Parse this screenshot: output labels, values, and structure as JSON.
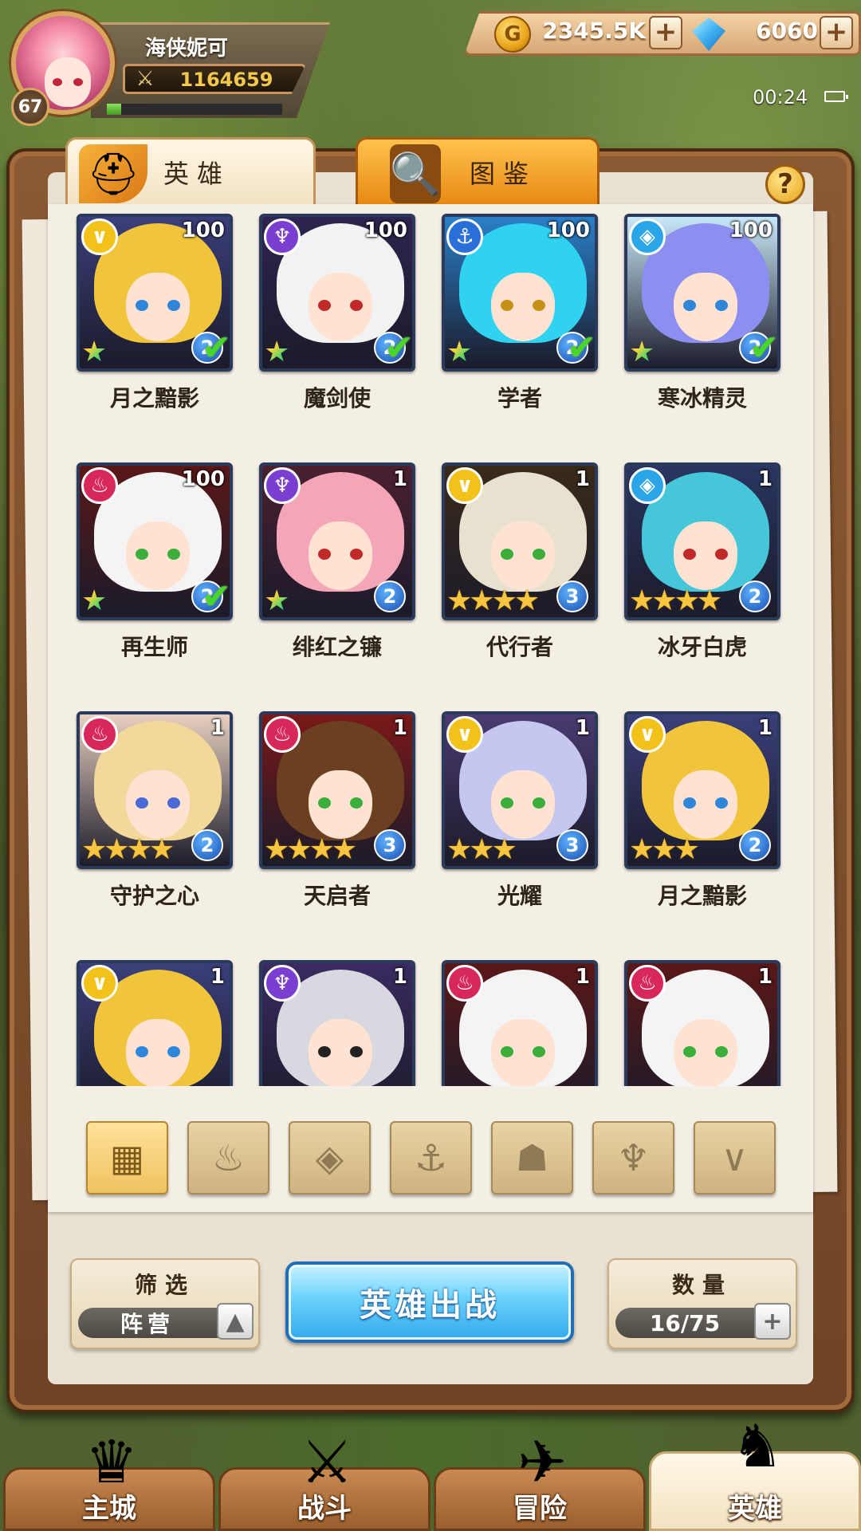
{
  "player": {
    "name": "海侠妮可",
    "level": "67",
    "power": "1164659",
    "xp_fraction": 0.08
  },
  "currency": {
    "gold": "2345.5K",
    "gems": "6060",
    "plus_glyph": "+"
  },
  "status": {
    "time": "00:24"
  },
  "tabs": [
    {
      "label": "英雄",
      "icon": "helmet-icon",
      "active": true
    },
    {
      "label": "图鉴",
      "icon": "magnifier-icon",
      "active": false
    }
  ],
  "help_label": "?",
  "heroes": [
    {
      "name": "月之黯影",
      "level": "100",
      "grade": "2",
      "stars": 1,
      "star_type": "rainbow",
      "collected": true,
      "faction": "light",
      "faction_color": "#f2c21b",
      "hair": "#f0c53c",
      "bg": "#3b3f7a",
      "eye": "#2f86d8"
    },
    {
      "name": "魔剑使",
      "level": "100",
      "grade": "2",
      "stars": 1,
      "star_type": "rainbow",
      "collected": true,
      "faction": "dark",
      "faction_color": "#7a3fd1",
      "hair": "#f2f2f2",
      "bg": "#2e2450",
      "eye": "#c02a2a"
    },
    {
      "name": "学者",
      "level": "100",
      "grade": "2",
      "stars": 1,
      "star_type": "rainbow",
      "collected": true,
      "faction": "water",
      "faction_color": "#2a6ed8",
      "hair": "#2fd3f0",
      "bg": "#2a7fc8",
      "eye": "#c79016"
    },
    {
      "name": "寒冰精灵",
      "level": "100",
      "grade": "2",
      "stars": 1,
      "star_type": "rainbow",
      "collected": true,
      "faction": "ice",
      "faction_color": "#2aa6e8",
      "hair": "#8d8ff0",
      "bg": "#c8e8f8",
      "eye": "#2f86d8"
    },
    {
      "name": "再生师",
      "level": "100",
      "grade": "2",
      "stars": 1,
      "star_type": "rainbow",
      "collected": true,
      "faction": "fire",
      "faction_color": "#d8285a",
      "hair": "#f4f4f4",
      "bg": "#5a1818",
      "eye": "#3cae3c"
    },
    {
      "name": "绯红之镰",
      "level": "1",
      "grade": "2",
      "stars": 1,
      "star_type": "rainbow",
      "collected": false,
      "faction": "dark",
      "faction_color": "#7a3fd1",
      "hair": "#f5a5b8",
      "bg": "#4a2030",
      "eye": "#c02a2a"
    },
    {
      "name": "代行者",
      "level": "1",
      "grade": "3",
      "stars": 4,
      "star_type": "gold",
      "collected": false,
      "faction": "light",
      "faction_color": "#f2c21b",
      "hair": "#e9e1cf",
      "bg": "#3a2a1a",
      "eye": "#3cae3c"
    },
    {
      "name": "冰牙白虎",
      "level": "1",
      "grade": "2",
      "stars": 4,
      "star_type": "gold",
      "collected": false,
      "faction": "ice",
      "faction_color": "#2aa6e8",
      "hair": "#46c7d9",
      "bg": "#2a3560",
      "eye": "#c02a2a"
    },
    {
      "name": "守护之心",
      "level": "1",
      "grade": "2",
      "stars": 4,
      "star_type": "gold",
      "collected": false,
      "faction": "fire",
      "faction_color": "#d8285a",
      "hair": "#f2d89a",
      "bg": "#e8d0c0",
      "eye": "#4a6ad8"
    },
    {
      "name": "天启者",
      "level": "1",
      "grade": "3",
      "stars": 4,
      "star_type": "gold",
      "collected": false,
      "faction": "fire",
      "faction_color": "#d8285a",
      "hair": "#6a4020",
      "bg": "#7a1818",
      "eye": "#3cae3c"
    },
    {
      "name": "光耀",
      "level": "1",
      "grade": "3",
      "stars": 3,
      "star_type": "gold",
      "collected": false,
      "faction": "light",
      "faction_color": "#f2c21b",
      "hair": "#c4c8f0",
      "bg": "#4a3a70",
      "eye": "#3cae3c"
    },
    {
      "name": "月之黯影",
      "level": "1",
      "grade": "2",
      "stars": 3,
      "star_type": "gold",
      "collected": false,
      "faction": "light",
      "faction_color": "#f2c21b",
      "hair": "#f0c53c",
      "bg": "#3b3f7a",
      "eye": "#2f86d8"
    },
    {
      "name": "",
      "level": "1",
      "grade": "",
      "stars": 0,
      "star_type": "gold",
      "collected": false,
      "faction": "light",
      "faction_color": "#f2c21b",
      "hair": "#f0c53c",
      "bg": "#3b3f7a",
      "eye": "#2f86d8"
    },
    {
      "name": "",
      "level": "1",
      "grade": "",
      "stars": 0,
      "star_type": "gold",
      "collected": false,
      "faction": "dark",
      "faction_color": "#7a3fd1",
      "hair": "#d8d8e0",
      "bg": "#3a2a60",
      "eye": "#222222"
    },
    {
      "name": "",
      "level": "1",
      "grade": "",
      "stars": 0,
      "star_type": "gold",
      "collected": false,
      "faction": "fire",
      "faction_color": "#d8285a",
      "hair": "#f4f4f4",
      "bg": "#5a1818",
      "eye": "#3cae3c"
    },
    {
      "name": "",
      "level": "1",
      "grade": "",
      "stars": 0,
      "star_type": "gold",
      "collected": false,
      "faction": "fire",
      "faction_color": "#d8285a",
      "hair": "#f4f4f4",
      "bg": "#5a1818",
      "eye": "#3cae3c"
    }
  ],
  "faction_filters": [
    {
      "name": "all",
      "icon": "grid-icon",
      "glyph": "▦",
      "active": true
    },
    {
      "name": "fire",
      "icon": "flame-icon",
      "glyph": "♨",
      "active": false
    },
    {
      "name": "ice",
      "icon": "diamond-icon",
      "glyph": "◈",
      "active": false
    },
    {
      "name": "water",
      "icon": "anchor-icon",
      "glyph": "⚓",
      "active": false
    },
    {
      "name": "beast",
      "icon": "beast-head-icon",
      "glyph": "☗",
      "active": false
    },
    {
      "name": "dark",
      "icon": "horns-icon",
      "glyph": "♆",
      "active": false
    },
    {
      "name": "light",
      "icon": "wings-icon",
      "glyph": "∨",
      "active": false
    }
  ],
  "controls": {
    "filter_title": "筛选",
    "filter_value": "阵营",
    "filter_toggle_glyph": "▲",
    "deploy_label": "英雄出战",
    "count_title": "数量",
    "count_value": "16/75",
    "count_plus_glyph": "+"
  },
  "nav": [
    {
      "label": "主城",
      "icon": "city-crest-icon",
      "glyph": "♛",
      "active": false
    },
    {
      "label": "战斗",
      "icon": "crossed-swords-icon",
      "glyph": "⚔",
      "active": false
    },
    {
      "label": "冒险",
      "icon": "map-scroll-icon",
      "glyph": "✈",
      "active": false
    },
    {
      "label": "英雄",
      "icon": "hero-helmet-icon",
      "glyph": "♞",
      "active": true
    }
  ]
}
